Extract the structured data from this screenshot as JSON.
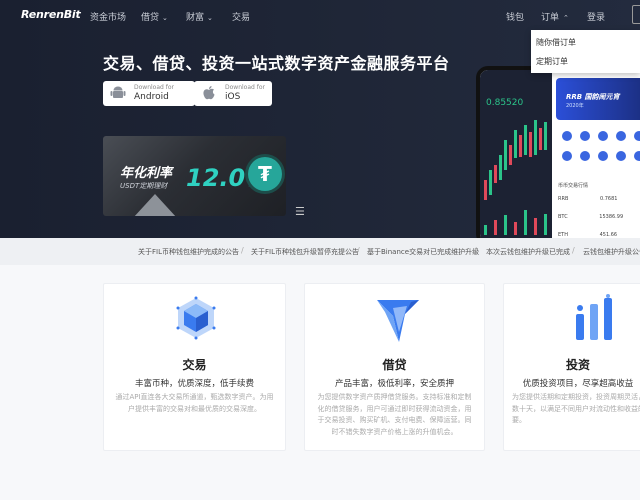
{
  "brand": {
    "logo": "RenrenBit"
  },
  "nav": {
    "items": [
      "资金市场",
      "借贷",
      "财富",
      "交易"
    ],
    "right": [
      "钱包",
      "订单",
      "登录"
    ],
    "order_dropdown": [
      "随你借订单",
      "定期订单"
    ]
  },
  "hero": {
    "headline": "交易、借贷、投资一站式数字资产金融服务平台",
    "android": {
      "small": "Download for",
      "large": "Android"
    },
    "ios": {
      "small": "Download for",
      "large": "iOS"
    },
    "banner": {
      "title": "年化利率",
      "subtitle": "USDT定期理财",
      "rate": "12.0%"
    },
    "phone": {
      "price": "0.85520",
      "banner_title": "RRB 国韵闹元宵",
      "banner_sub": "2020年",
      "rows": [
        "币币交易行情",
        "RRB",
        "BTC",
        "ETH"
      ],
      "row_values": [
        "0.7681",
        "15386.99",
        "451.66"
      ]
    }
  },
  "ticker": [
    "关于FIL币种钱包维护完成的公告",
    "关于FIL币种钱包升级暂停充提公告",
    "基于Binance交易对已完成维护升级",
    "本次云钱包维护升级已完成",
    "云钱包维护升级公告"
  ],
  "cards": [
    {
      "title": "交易",
      "sub": "丰富币种，优质深度，低手续费",
      "desc": "通过API直连各大交易所通道，甄选数字资产。为用户提供丰富的交易对和最优质的交易深度。"
    },
    {
      "title": "借贷",
      "sub": "产品丰富，极低利率，安全质押",
      "desc": "为您提供数字资产质押借贷服务。支持标准和定制化的借贷服务，用户可通过即时获得流动资金，用于交易投资、购买矿机、支付电费、保障运营。同时不错失数字资产价格上涨的升值机会。"
    },
    {
      "title": "投资",
      "sub": "优质投资项目，尽享超高收益",
      "desc": "为您提供活期和定期投资，投资周期灵活，收取到数十天，以满足不同用户对流动性和收益的回需要。"
    }
  ],
  "colors": {
    "hero_bg": "#1f2637",
    "accent_teal": "#2fd1c1",
    "accent_blue": "#3a66e0"
  }
}
